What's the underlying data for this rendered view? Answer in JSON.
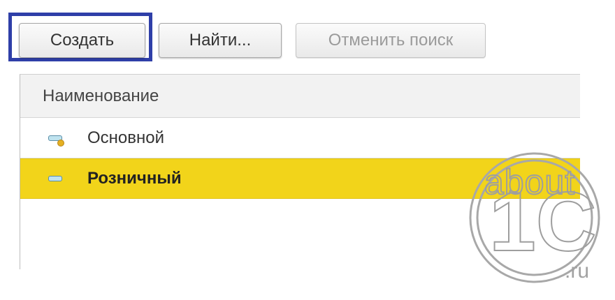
{
  "toolbar": {
    "create_label": "Создать",
    "find_label": "Найти...",
    "cancel_search_label": "Отменить поиск"
  },
  "table": {
    "column_header": "Наименование",
    "rows": [
      {
        "label": "Основной",
        "icon": "item-default-icon",
        "selected": false
      },
      {
        "label": "Розничный",
        "icon": "item-icon",
        "selected": true
      }
    ]
  },
  "watermark": {
    "line1": "about",
    "line2": "1C",
    "line3": ".ru"
  },
  "colors": {
    "highlight_frame": "#2f3fa8",
    "selected_row": "#f2d41a"
  }
}
